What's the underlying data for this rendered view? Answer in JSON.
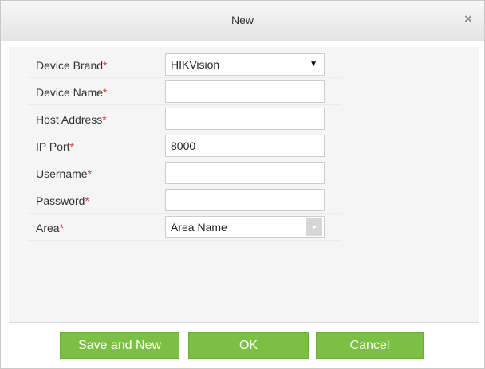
{
  "dialog": {
    "title": "New",
    "close_symbol": "×"
  },
  "form": {
    "device_brand": {
      "label": "Device Brand",
      "value": "HIKVision",
      "arrow": "▼"
    },
    "device_name": {
      "label": "Device Name",
      "value": ""
    },
    "host_address": {
      "label": "Host Address",
      "value": ""
    },
    "ip_port": {
      "label": "IP Port",
      "value": "8000"
    },
    "username": {
      "label": "Username",
      "value": ""
    },
    "password": {
      "label": "Password",
      "value": ""
    },
    "area": {
      "label": "Area",
      "value": "Area Name"
    },
    "required_mark": "*"
  },
  "buttons": {
    "save_and_new": "Save and New",
    "ok": "OK",
    "cancel": "Cancel"
  },
  "colors": {
    "button_green": "#7cc043",
    "required_red": "#e8312f"
  }
}
